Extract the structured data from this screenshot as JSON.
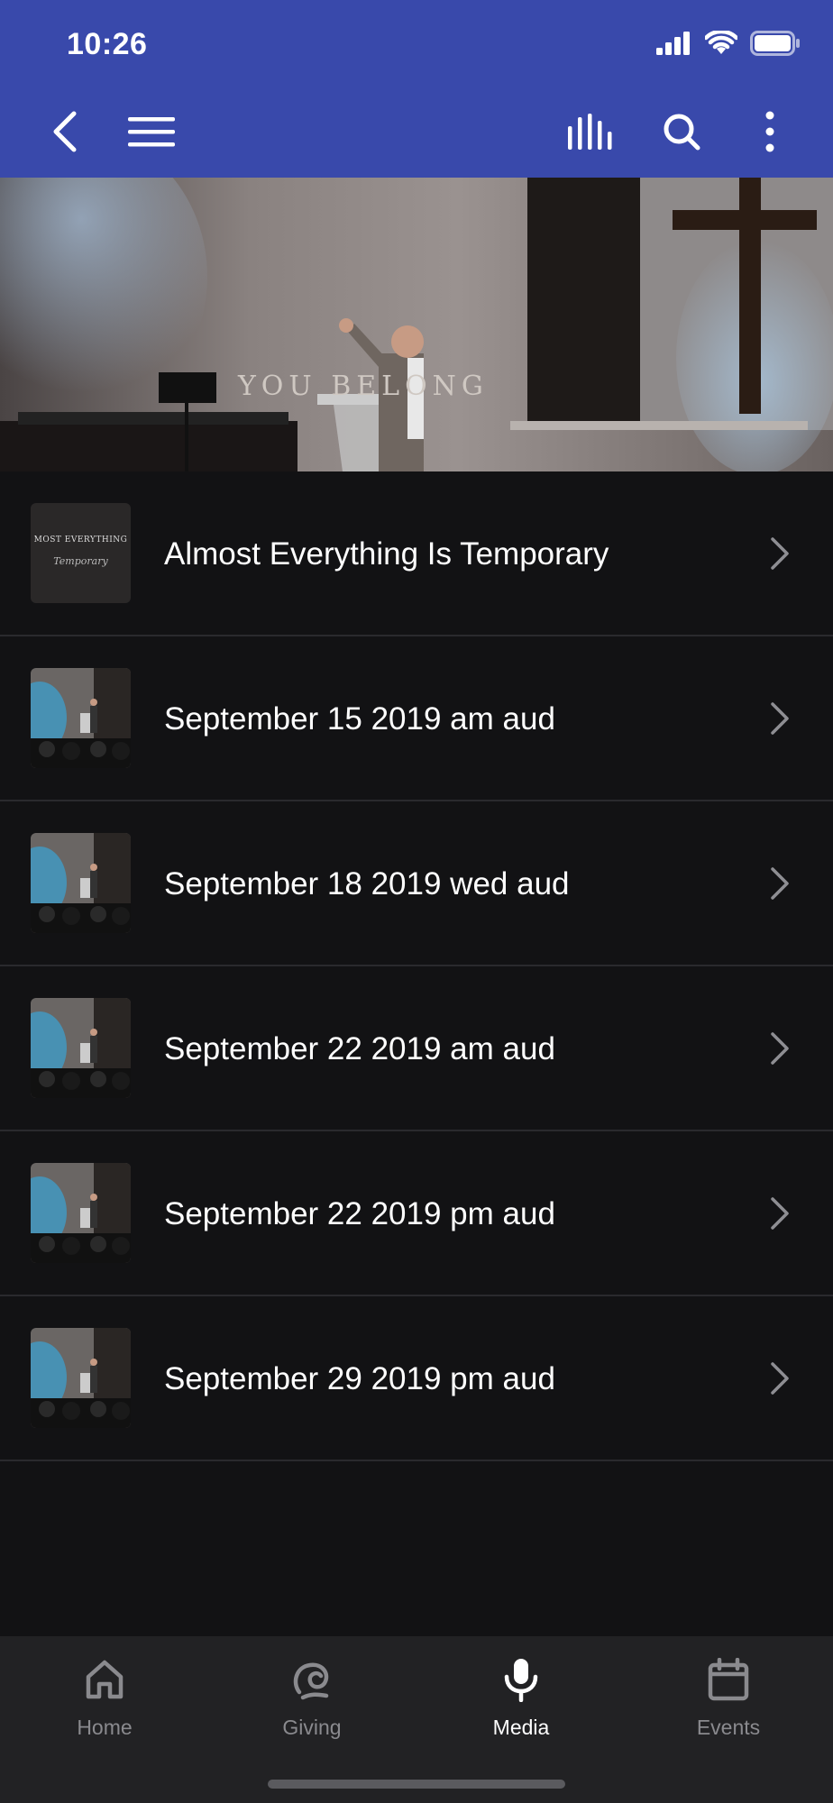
{
  "status_bar": {
    "time": "10:26"
  },
  "app_bar": {
    "icons": [
      "chevron-left-icon",
      "hamburger-menu-icon",
      "audio-bars-icon",
      "search-icon",
      "more-vertical-icon"
    ],
    "color": "#3949ab"
  },
  "hero": {
    "caption": "YOU BELONG"
  },
  "list": {
    "items": [
      {
        "title": "Almost Everything Is Temporary",
        "thumb_text": "MOST EVERYTHING",
        "thumb_script": "Temporary"
      },
      {
        "title": "September 15 2019 am aud"
      },
      {
        "title": "September 18 2019 wed aud"
      },
      {
        "title": "September 22 2019 am aud"
      },
      {
        "title": "September 22 2019 pm aud"
      },
      {
        "title": "September 29 2019 pm aud"
      }
    ]
  },
  "tabbar": {
    "tabs": [
      {
        "label": "Home",
        "icon": "home-icon",
        "active": false
      },
      {
        "label": "Giving",
        "icon": "giving-icon",
        "active": false
      },
      {
        "label": "Media",
        "icon": "microphone-icon",
        "active": true
      },
      {
        "label": "Events",
        "icon": "calendar-icon",
        "active": false
      }
    ],
    "active_color": "#ffffff",
    "inactive_color": "#8a8a8e"
  }
}
